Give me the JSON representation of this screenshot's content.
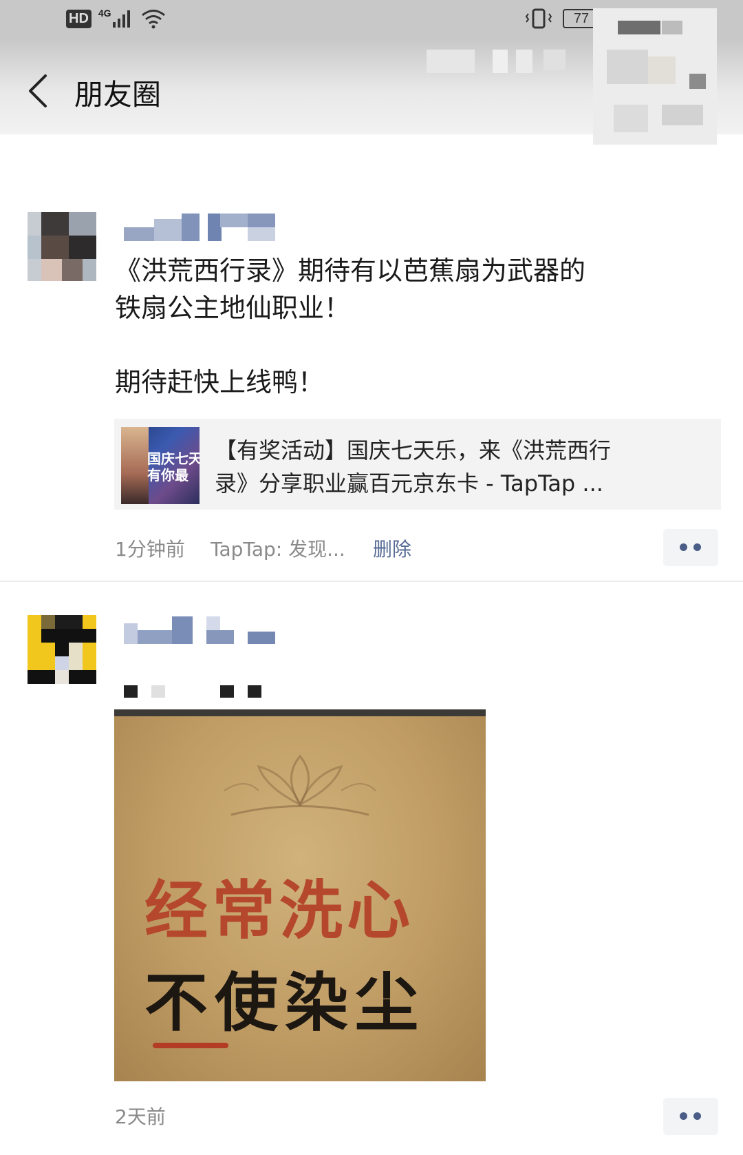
{
  "status_bar": {
    "hd": "HD",
    "network": "4G",
    "battery": "77"
  },
  "header": {
    "title": "朋友圈"
  },
  "posts": [
    {
      "text_line1": "《洪荒西行录》期待有以芭蕉扇为武器的",
      "text_line2": "铁扇公主地仙职业！",
      "text_line3": "期待赶快上线鸭！",
      "link_card": {
        "thumb_text_1": "国庆七天",
        "thumb_text_2": "有你最",
        "title_line1": "【有奖活动】国庆七天乐，来《洪荒西行",
        "title_line2": "录》分享职业赢百元京东卡 - TapTap ..."
      },
      "time": "1分钟前",
      "source": "TapTap: 发现...",
      "delete": "删除"
    },
    {
      "image_text_line1": "经常洗心",
      "image_text_line2": "不使染尘",
      "time": "2天前"
    }
  ],
  "colors": {
    "link": "#576b95",
    "meta": "#8a8a8a",
    "dots": "#4a5d87"
  }
}
